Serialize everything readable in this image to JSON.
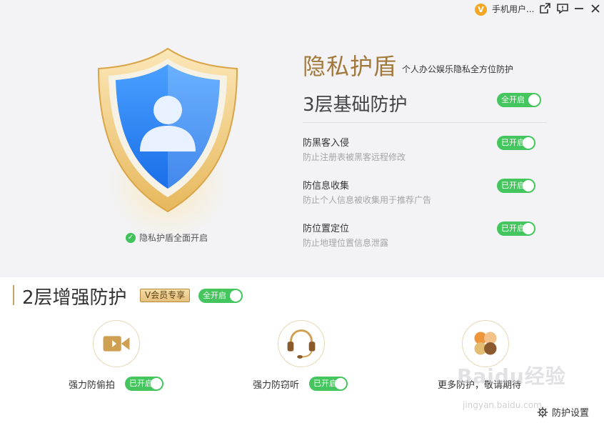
{
  "titlebar": {
    "vip_glyph": "V",
    "user_label": "手机用户..."
  },
  "hero": {
    "title": "隐私护盾",
    "subtitle": "个人办公娱乐隐私全方位防护",
    "status": "隐私护盾全面开启"
  },
  "basic": {
    "title": "3层基础防护",
    "toggle_all": "全开启",
    "items": [
      {
        "title": "防黑客入侵",
        "desc": "防止注册表被黑客远程修改",
        "toggle": "已开启"
      },
      {
        "title": "防信息收集",
        "desc": "防止个人信息被收集用于推荐广告",
        "toggle": "已开启"
      },
      {
        "title": "防位置定位",
        "desc": "防止地理位置信息泄露",
        "toggle": "已开启"
      }
    ]
  },
  "enhanced": {
    "title": "2层增强防护",
    "vip_badge": "V会员专享",
    "toggle_all": "全开启",
    "features": [
      {
        "label": "强力防偷拍",
        "toggle": "已开启",
        "icon": "camera-icon"
      },
      {
        "label": "强力防窃听",
        "toggle": "已开启",
        "icon": "headset-icon"
      },
      {
        "label": "更多防护，敬请期待",
        "icon": "more-icon"
      }
    ]
  },
  "watermark": {
    "text": "Baidu经验",
    "sub": "jingyan.baidu.com"
  },
  "footer": {
    "settings_label": "防护设置"
  },
  "colors": {
    "accent_green": "#44c55d",
    "gold": "#a2783b",
    "shield_blue": "#2f7ff0",
    "panel_bg": "#f3f3f5"
  }
}
